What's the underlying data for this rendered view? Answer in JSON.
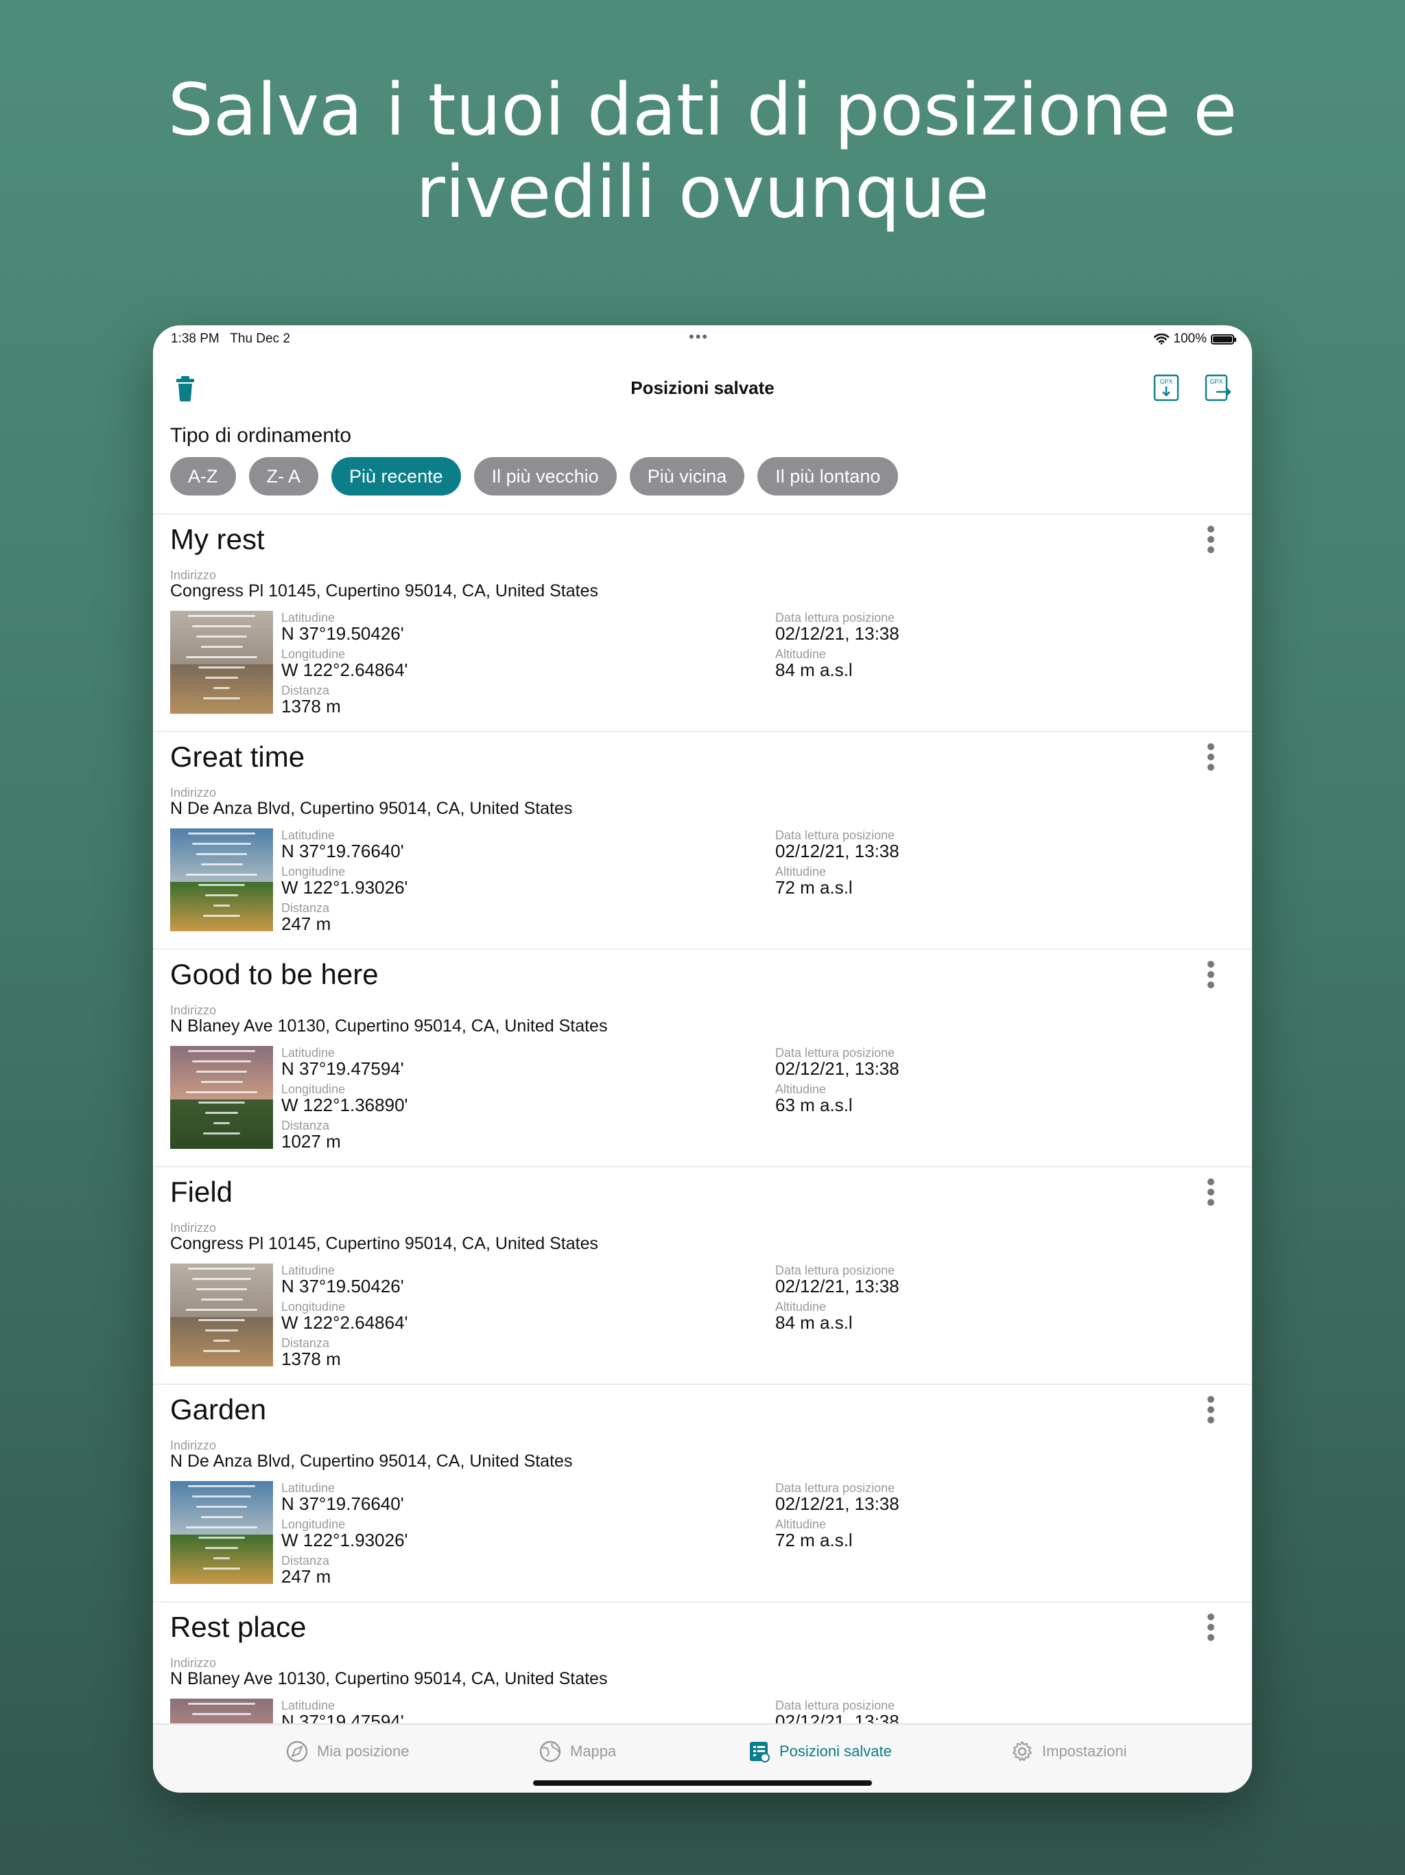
{
  "headline": {
    "line1": "Salva i tuoi dati di posizione e",
    "line2": "rivedili ovunque"
  },
  "status_bar": {
    "time": "1:38 PM",
    "date": "Thu Dec 2",
    "battery": "100%",
    "battery_level": 1.0
  },
  "nav": {
    "title": "Posizioni salvate",
    "left_icon": "trash-icon",
    "right_icons": [
      "gpx-import-icon",
      "gpx-export-icon"
    ]
  },
  "sort": {
    "label": "Tipo di ordinamento",
    "options": [
      "A-Z",
      "Z- A",
      "Più recente",
      "Il più vecchio",
      "Più vicina",
      "Il più lontano"
    ],
    "selected": "Più recente"
  },
  "field_labels": {
    "address": "Indirizzo",
    "latitude": "Latitudine",
    "longitude": "Longitudine",
    "distance": "Distanza",
    "read_date": "Data lettura posizione",
    "altitude": "Altitudine"
  },
  "locations": [
    {
      "name": "My rest",
      "address": "Congress Pl 10145, Cupertino 95014, CA, United States",
      "latitude": "N 37°19.50426'",
      "longitude": "W 122°2.64864'",
      "distance": "1378 m",
      "date": "02/12/21, 13:38",
      "altitude": "84 m a.s.l"
    },
    {
      "name": "Great time",
      "address": "N De Anza Blvd, Cupertino 95014, CA, United States",
      "latitude": "N 37°19.76640'",
      "longitude": "W 122°1.93026'",
      "distance": "247 m",
      "date": "02/12/21, 13:38",
      "altitude": "72 m a.s.l"
    },
    {
      "name": "Good to be here",
      "address": "N Blaney Ave 10130, Cupertino 95014, CA, United States",
      "latitude": "N 37°19.47594'",
      "longitude": "W 122°1.36890'",
      "distance": "1027 m",
      "date": "02/12/21, 13:38",
      "altitude": "63 m a.s.l"
    },
    {
      "name": "Field",
      "address": "Congress Pl 10145, Cupertino 95014, CA, United States",
      "latitude": "N 37°19.50426'",
      "longitude": "W 122°2.64864'",
      "distance": "1378 m",
      "date": "02/12/21, 13:38",
      "altitude": "84 m a.s.l"
    },
    {
      "name": "Garden",
      "address": "N De Anza Blvd, Cupertino 95014, CA, United States",
      "latitude": "N 37°19.76640'",
      "longitude": "W 122°1.93026'",
      "distance": "247 m",
      "date": "02/12/21, 13:38",
      "altitude": "72 m a.s.l"
    },
    {
      "name": "Rest place",
      "address": "N Blaney Ave 10130, Cupertino 95014, CA, United States",
      "latitude": "N 37°19.47594'",
      "longitude": "",
      "distance": "",
      "date": "02/12/21, 13:38",
      "altitude": ""
    }
  ],
  "tabs": [
    {
      "label": "Mia posizione",
      "icon": "compass-icon",
      "active": false
    },
    {
      "label": "Mappa",
      "icon": "globe-icon",
      "active": false
    },
    {
      "label": "Posizioni salvate",
      "icon": "saved-list-icon",
      "active": true
    },
    {
      "label": "Impostazioni",
      "icon": "gear-icon",
      "active": false
    }
  ],
  "colors": {
    "accent": "#0b7e8a",
    "chip_inactive": "#8e8e93",
    "background_top": "#4f8d7b",
    "background_bottom": "#33574e"
  }
}
